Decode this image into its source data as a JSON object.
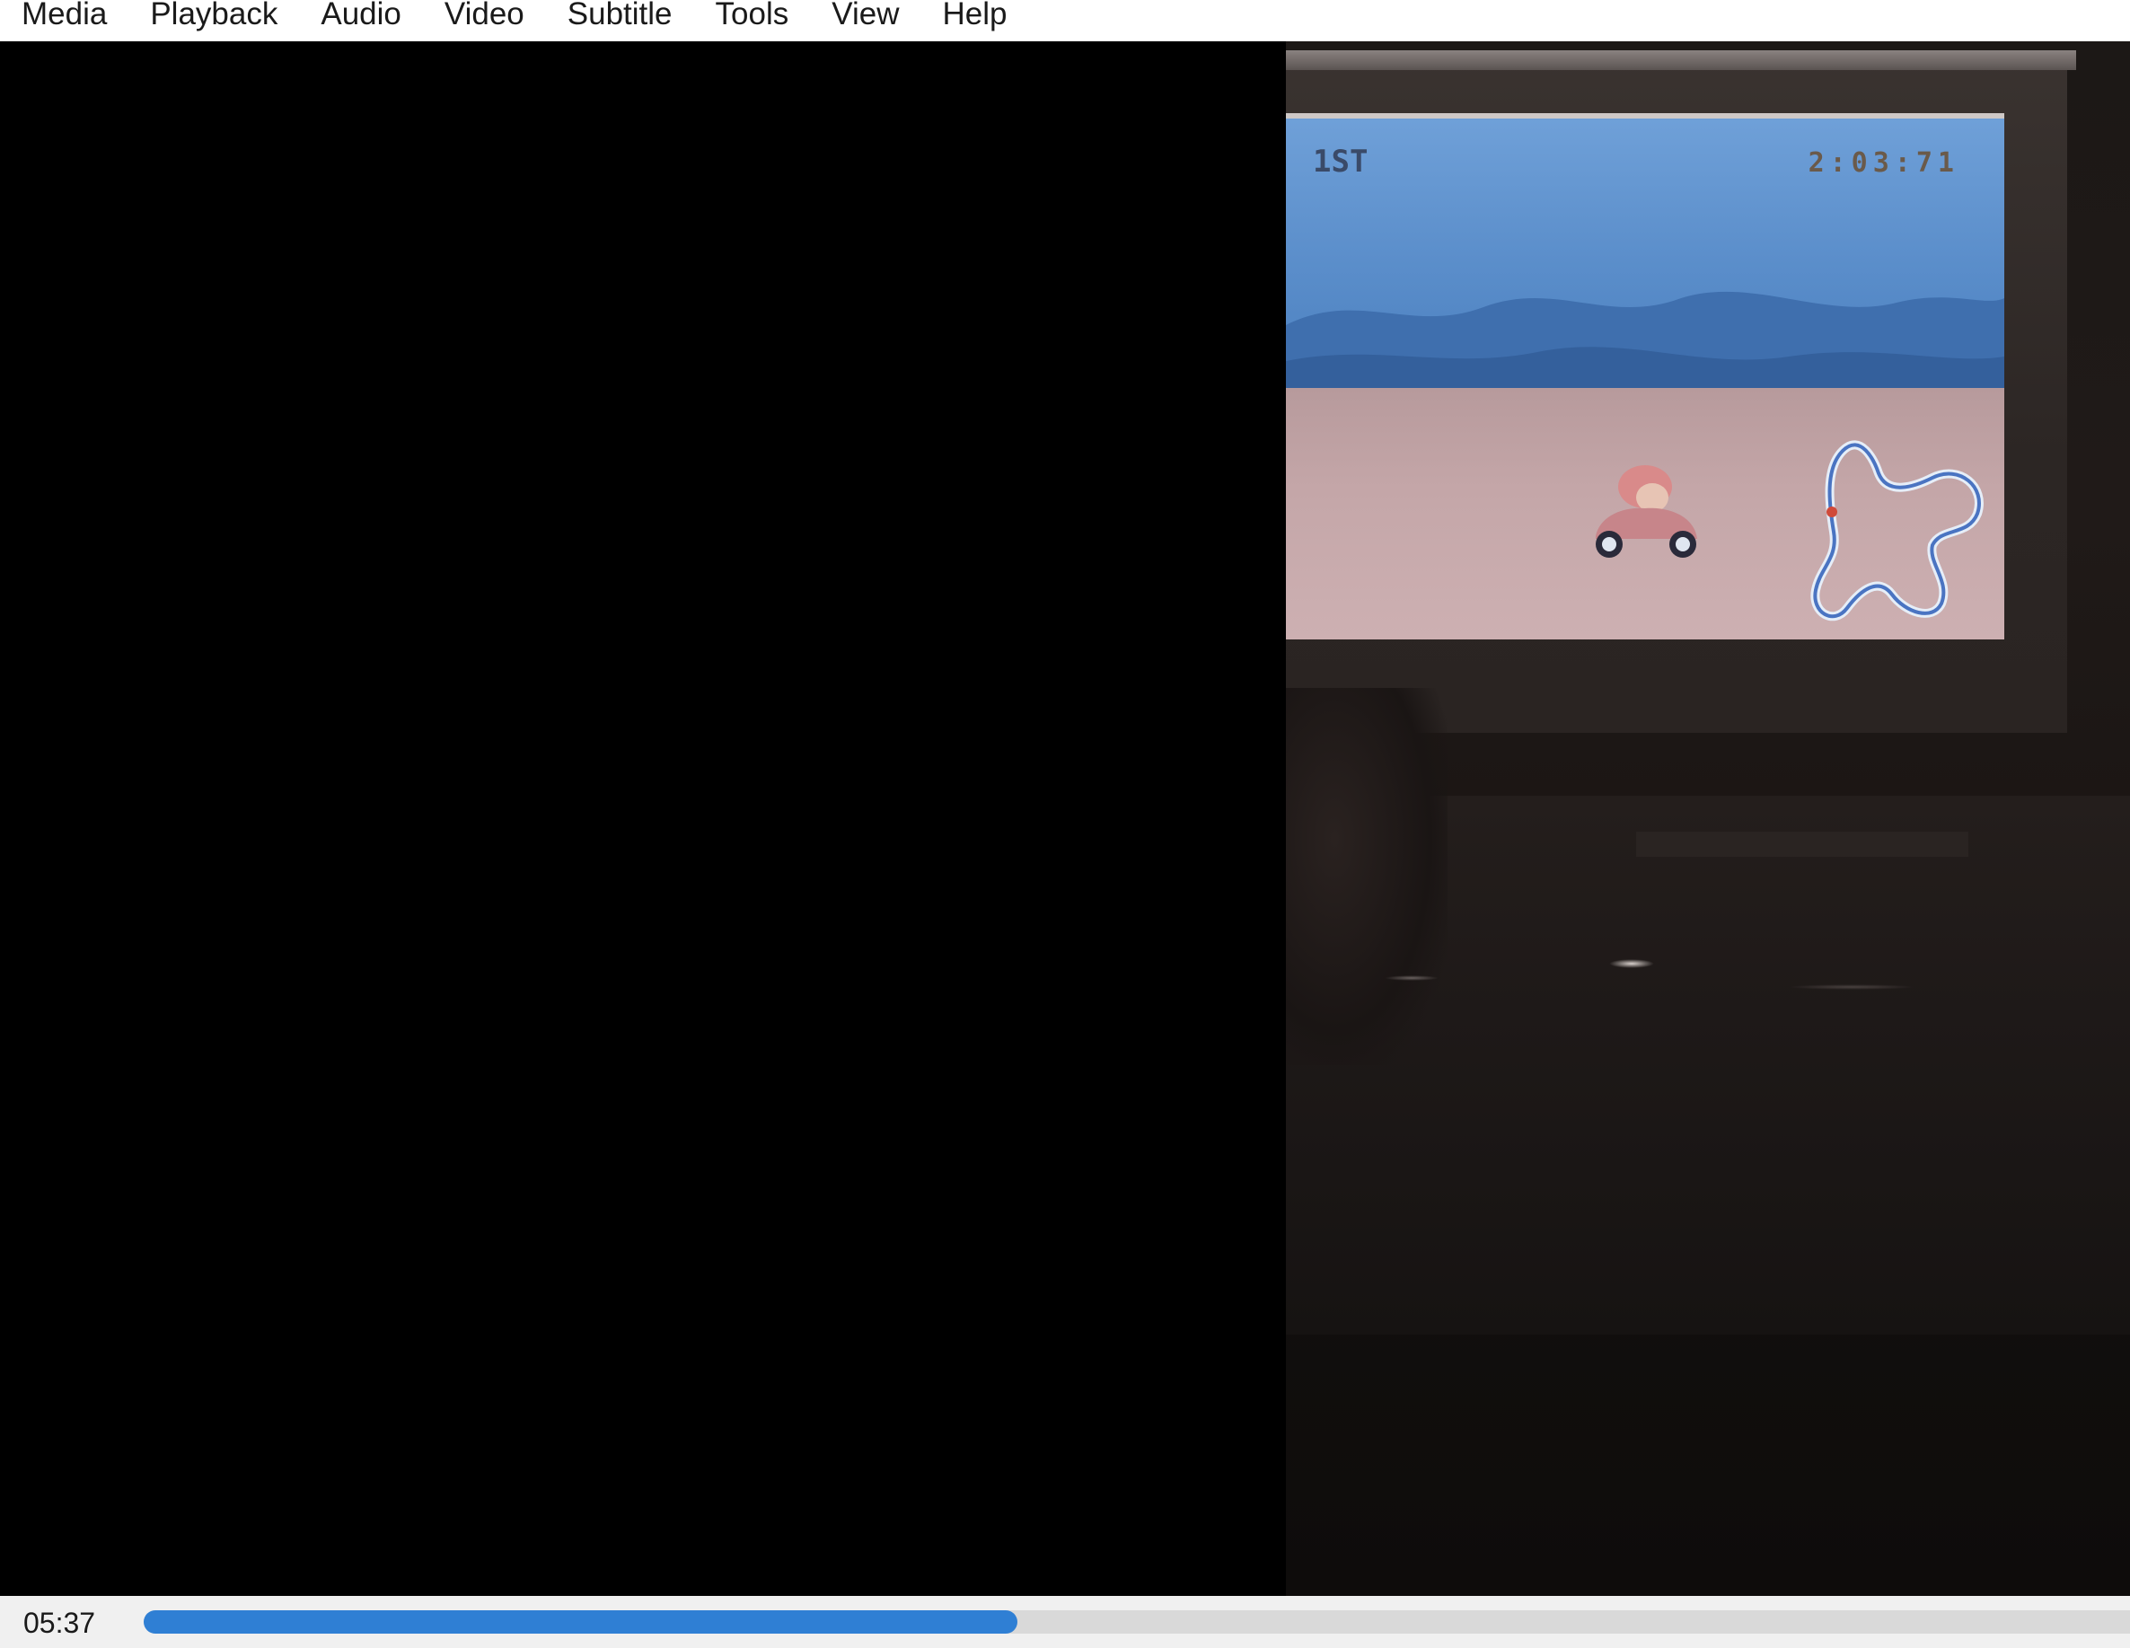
{
  "menubar": {
    "items": [
      "Media",
      "Playback",
      "Audio",
      "Video",
      "Subtitle",
      "Tools",
      "View",
      "Help"
    ]
  },
  "video": {
    "hud_position": "1ST",
    "hud_time": "2:03:71"
  },
  "controls": {
    "elapsed": "05:37",
    "progress_fraction": 0.44,
    "accent_color": "#2f7fd4"
  }
}
